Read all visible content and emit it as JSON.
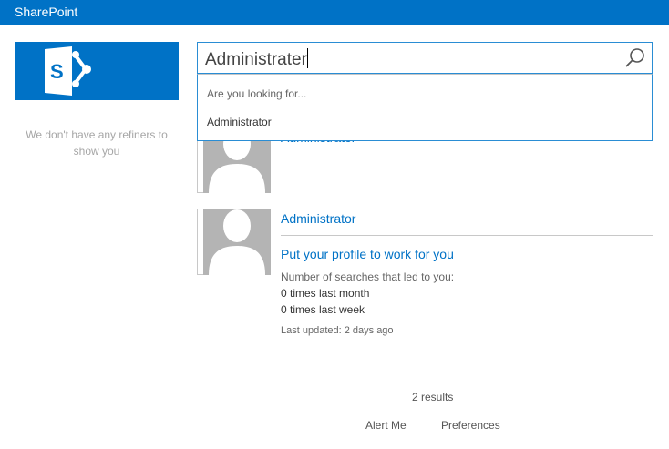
{
  "header": {
    "title": "SharePoint"
  },
  "refiners": {
    "message": "We don't have any refiners to show you"
  },
  "search": {
    "value": "Administrater"
  },
  "suggestions": {
    "heading": "Are you looking for...",
    "items": [
      "Administrator"
    ]
  },
  "results": [
    {
      "name": "Administrator"
    },
    {
      "name": "Administrator",
      "promo_title": "Put your profile to work for you",
      "searches_label": "Number of searches that led to you:",
      "last_month": "0 times last month",
      "last_week": "0 times last week",
      "last_updated": "Last updated: 2 days ago"
    }
  ],
  "footer": {
    "count": "2 results",
    "alert_me": "Alert Me",
    "preferences": "Preferences"
  },
  "colors": {
    "brand": "#0072c6"
  }
}
